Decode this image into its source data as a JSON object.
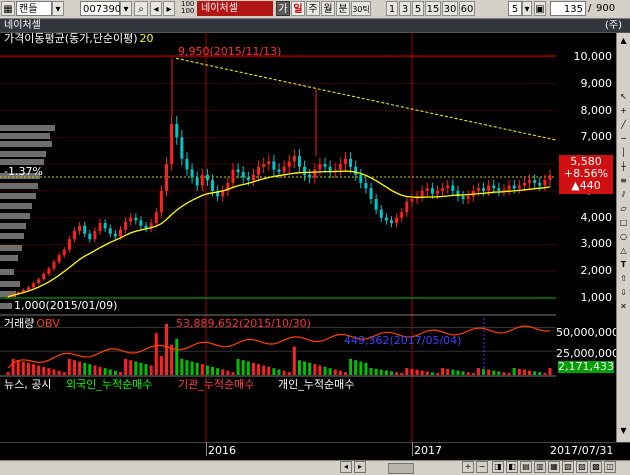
{
  "toolbar": {
    "chart_type": "캔들",
    "code": "007390",
    "stock_name": "네이처셀",
    "unit_top": "100",
    "unit_bottom": "100",
    "buttons": [
      "가",
      "일",
      "주",
      "월",
      "분",
      "30틱",
      "1",
      "3",
      "5",
      "15",
      "30",
      "60"
    ],
    "active_button": "일",
    "n_value": "5",
    "count": "135",
    "total": "900"
  },
  "title": {
    "name": "네이처셀",
    "badge": "(주)"
  },
  "main_panel": {
    "label": "가격이동평균(동가,단순이평)",
    "ma_period": "20",
    "high_label": "9,950(2015/11/13)",
    "low_label": "1,000(2015/01/09)",
    "pct_label": "-1.37%"
  },
  "price_box": {
    "price": "5,580",
    "pct": "+8.56%",
    "change": "▲440"
  },
  "volume_panel": {
    "label": "거래량",
    "obv_label": "OBV",
    "max_label": "53,889,652(2015/10/30)",
    "obv_label2": "449,362(2017/05/04)",
    "last": "2,171,433"
  },
  "investor_panel": {
    "labels": [
      "뉴스, 공시",
      "외국인_누적순매수",
      "기관_누적순매수",
      "개인_누적순매수"
    ]
  },
  "x_labels": [
    "2016",
    "2017",
    "2017/07/31"
  ],
  "chart_data": {
    "type": "candlestick",
    "y_ticks": [
      "10,000",
      "9,000",
      "8,000",
      "7,000",
      "6,000",
      "5,000",
      "4,000",
      "3,000",
      "2,000",
      "1,000"
    ],
    "ylim": [
      1000,
      10500
    ],
    "vol_ticks": [
      "50,000,000",
      "25,000,000"
    ],
    "vol_max": 60000000,
    "x_start": "2015/01",
    "x_end": "2017/07/31",
    "months": 31,
    "close": [
      1050,
      1150,
      1220,
      1300,
      1400,
      1550,
      1700,
      1900,
      2100,
      2350,
      2600,
      2800,
      3200,
      3500,
      3700,
      3400,
      3200,
      3500,
      3800,
      3600,
      3400,
      3300,
      3550,
      3850,
      4000,
      3900,
      3700,
      3600,
      3800,
      4200,
      5000,
      6000,
      7500,
      7000,
      6200,
      5800,
      5500,
      5200,
      5600,
      5400,
      5000,
      4800,
      5000,
      5300,
      5800,
      5700,
      5500,
      5400,
      5600,
      5900,
      6000,
      6100,
      5800,
      5700,
      5900,
      6100,
      6300,
      5900,
      5600,
      5500,
      5800,
      6000,
      5900,
      5700,
      5800,
      6000,
      6200,
      5900,
      5600,
      5300,
      5100,
      4700,
      4300,
      4000,
      3900,
      3800,
      4000,
      4200,
      4600,
      4700,
      4800,
      5000,
      5100,
      4900,
      5000,
      5100,
      5200,
      5000,
      4800,
      4700,
      4800,
      5000,
      5100,
      5000,
      5200,
      5100,
      5000,
      5050,
      5200,
      5100,
      5200,
      5300,
      5400,
      5300,
      5200,
      5400,
      5580
    ],
    "ma20": [
      1050,
      1100,
      1150,
      1200,
      1260,
      1330,
      1410,
      1500,
      1600,
      1720,
      1850,
      1990,
      2140,
      2290,
      2440,
      2560,
      2660,
      2770,
      2880,
      2980,
      3080,
      3160,
      3250,
      3340,
      3430,
      3490,
      3540,
      3580,
      3620,
      3680,
      3780,
      3930,
      4120,
      4280,
      4420,
      4540,
      4650,
      4740,
      4830,
      4890,
      4930,
      4960,
      5000,
      5060,
      5130,
      5190,
      5240,
      5280,
      5340,
      5400,
      5450,
      5500,
      5540,
      5570,
      5600,
      5630,
      5660,
      5680,
      5690,
      5690,
      5700,
      5710,
      5720,
      5720,
      5720,
      5730,
      5740,
      5730,
      5700,
      5650,
      5580,
      5490,
      5380,
      5260,
      5140,
      5020,
      4920,
      4840,
      4790,
      4770,
      4760,
      4760,
      4770,
      4770,
      4780,
      4790,
      4810,
      4830,
      4840,
      4850,
      4860,
      4880,
      4900,
      4910,
      4930,
      4950,
      4960,
      4970,
      4990,
      5000,
      5020,
      5040,
      5060,
      5080,
      5100,
      5120,
      5150
    ],
    "trendline": [
      [
        9950,
        "2015/11/13"
      ],
      [
        6900,
        "2017/07/31"
      ]
    ],
    "colors": {
      "up": "#ff2020",
      "down": "#00c8c8",
      "ma": "#ffff00",
      "trend": "#ffff00",
      "obv": "#ff4000",
      "grid": "#c00000",
      "high_line": "#d00000",
      "low_line": "#00c000"
    }
  }
}
